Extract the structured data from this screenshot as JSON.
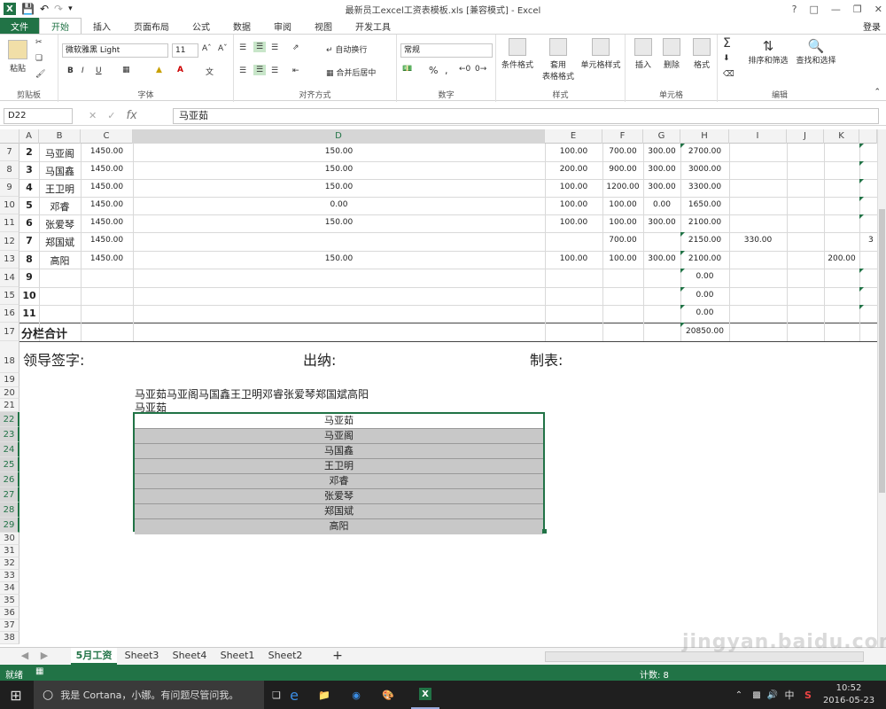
{
  "window": {
    "title": "最新员工excel工资表模板.xls  [兼容模式] - Excel",
    "help": "?"
  },
  "tabs": {
    "file": "文件",
    "items": [
      "开始",
      "插入",
      "页面布局",
      "公式",
      "数据",
      "审阅",
      "视图",
      "开发工具"
    ],
    "login": "登录"
  },
  "ribbon": {
    "clipboard": {
      "label": "剪贴板",
      "paste": "粘贴"
    },
    "font": {
      "label": "字体",
      "name": "微软雅黑 Light",
      "size": "11",
      "bold": "B",
      "italic": "I",
      "underline": "U"
    },
    "align": {
      "label": "对齐方式",
      "wrap": "自动换行",
      "merge": "合并后居中"
    },
    "number": {
      "label": "数字",
      "format": "常规",
      "percent": "%",
      "comma": ","
    },
    "styles": {
      "label": "样式",
      "cond": "条件格式",
      "table1": "套用",
      "table2": "表格格式",
      "cell": "单元格样式"
    },
    "cells": {
      "label": "单元格",
      "insert": "插入",
      "delete": "删除",
      "format": "格式"
    },
    "edit": {
      "label": "编辑",
      "sort": "排序和筛选",
      "find": "查找和选择"
    }
  },
  "formula": {
    "namebox": "D22",
    "fx": "fx",
    "value": "马亚茹"
  },
  "columns": [
    "A",
    "B",
    "C",
    "D",
    "E",
    "F",
    "G",
    "H",
    "I",
    "J",
    "K"
  ],
  "rows": {
    "r7": {
      "num": "7",
      "a": "2",
      "b": "马亚阁",
      "c": "1450.00",
      "d": "150.00",
      "e": "100.00",
      "f": "700.00",
      "g": "300.00",
      "h": "2700.00"
    },
    "r8": {
      "num": "8",
      "a": "3",
      "b": "马国鑫",
      "c": "1450.00",
      "d": "150.00",
      "e": "200.00",
      "f": "900.00",
      "g": "300.00",
      "h": "3000.00"
    },
    "r9": {
      "num": "9",
      "a": "4",
      "b": "王卫明",
      "c": "1450.00",
      "d": "150.00",
      "e": "100.00",
      "f": "1200.00",
      "g": "300.00",
      "h": "3300.00"
    },
    "r10": {
      "num": "10",
      "a": "5",
      "b": "邓睿",
      "c": "1450.00",
      "d": "0.00",
      "e": "100.00",
      "f": "100.00",
      "g": "0.00",
      "h": "1650.00"
    },
    "r11": {
      "num": "11",
      "a": "6",
      "b": "张爱琴",
      "c": "1450.00",
      "d": "150.00",
      "e": "100.00",
      "f": "100.00",
      "g": "300.00",
      "h": "2100.00"
    },
    "r12": {
      "num": "12",
      "a": "7",
      "b": "郑国斌",
      "c": "1450.00",
      "f": "700.00",
      "h": "2150.00",
      "i": "330.00",
      "l": "3"
    },
    "r13": {
      "num": "13",
      "a": "8",
      "b": "高阳",
      "c": "1450.00",
      "d": "150.00",
      "e": "100.00",
      "f": "100.00",
      "g": "300.00",
      "h": "2100.00",
      "k": "200.00"
    },
    "r14": {
      "num": "14",
      "a": "9",
      "h": "0.00"
    },
    "r15": {
      "num": "15",
      "a": "10",
      "h": "0.00"
    },
    "r16": {
      "num": "16",
      "a": "11",
      "h": "0.00"
    },
    "r17": {
      "num": "17",
      "label": "分栏合计",
      "h": "20850.00"
    },
    "r18": {
      "num": "18",
      "leader": "领导签字:",
      "cashier": "出纳:",
      "maker": "制表:"
    },
    "r20": {
      "num": "20",
      "text": "马亚茹马亚阁马国鑫王卫明邓睿张爱琴郑国斌高阳"
    },
    "r21": {
      "num": "21",
      "text": "马亚茹"
    }
  },
  "rownums_rest": [
    "22",
    "23",
    "24",
    "25",
    "26",
    "27",
    "28",
    "29",
    "30",
    "31",
    "32",
    "33",
    "34",
    "35",
    "36",
    "37",
    "38"
  ],
  "list": [
    "马亚茹",
    "马亚阁",
    "马国鑫",
    "王卫明",
    "邓睿",
    "张爱琴",
    "郑国斌",
    "高阳"
  ],
  "sheets": [
    "5月工资",
    "Sheet3",
    "Sheet4",
    "Sheet1",
    "Sheet2"
  ],
  "add_sheet": "+",
  "status": {
    "ready": "就绪",
    "count": "计数: 8"
  },
  "taskbar": {
    "cortana": "我是 Cortana，小娜。有问题尽管问我。",
    "time": "10:52",
    "date": "2016-05-23",
    "ime": "中"
  },
  "watermark": "jingyan.baidu.com"
}
